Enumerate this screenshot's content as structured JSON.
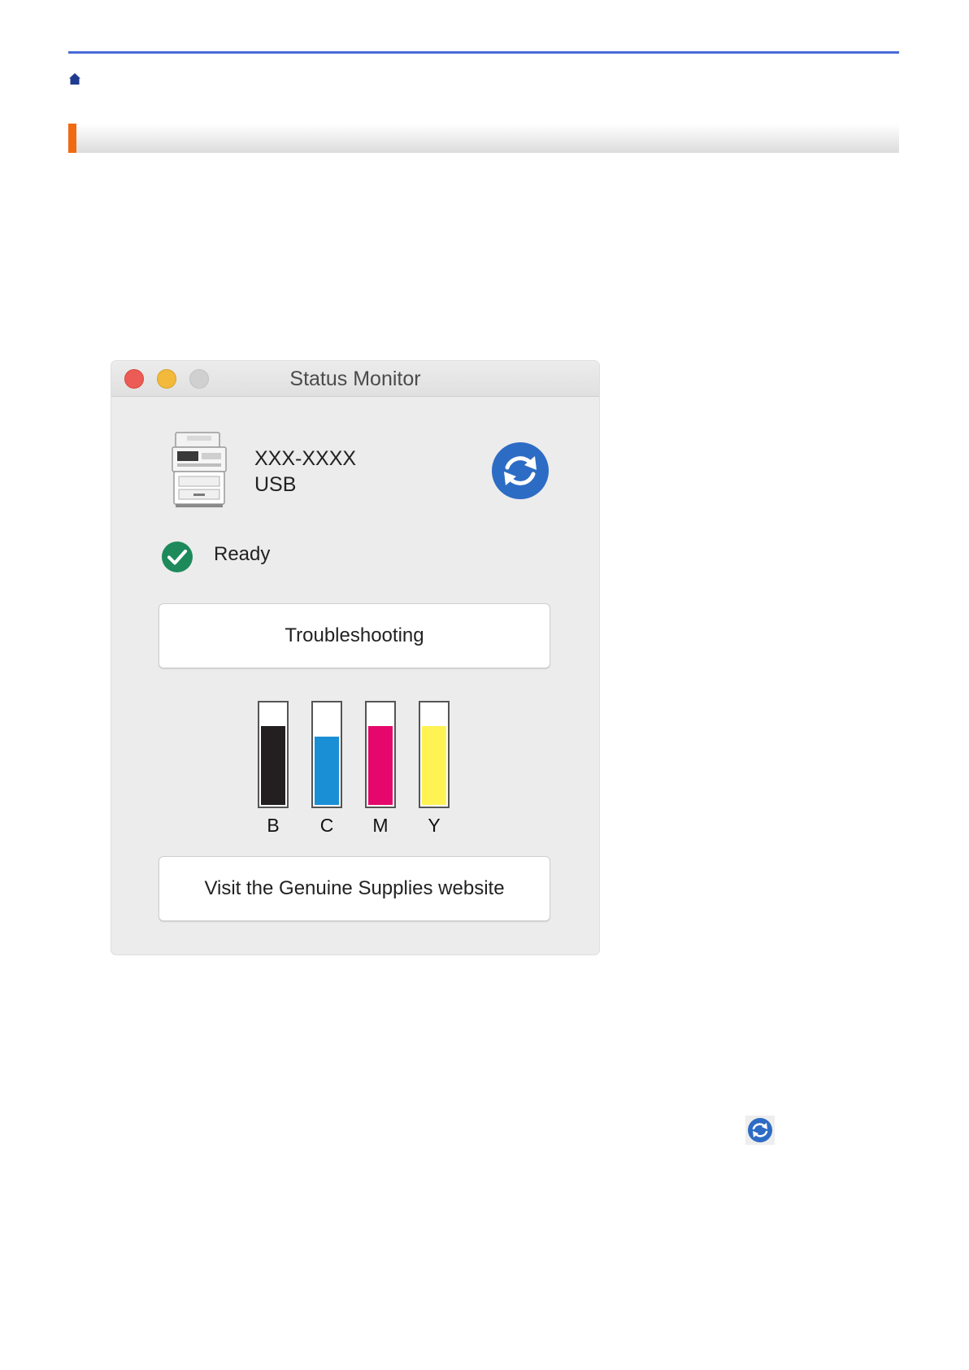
{
  "window": {
    "title": "Status Monitor",
    "device": {
      "model": "XXX-XXXX",
      "connection": "USB"
    },
    "status": {
      "text": "Ready",
      "color": "#1e8a5c"
    },
    "troubleshooting_label": "Troubleshooting",
    "supplies_label": "Visit the Genuine Supplies website",
    "inks": [
      {
        "label": "B",
        "color": "#231f20",
        "level": 0.78
      },
      {
        "label": "C",
        "color": "#1b8fd6",
        "level": 0.68
      },
      {
        "label": "M",
        "color": "#e5076c",
        "level": 0.78
      },
      {
        "label": "Y",
        "color": "#fff353",
        "level": 0.78
      }
    ]
  },
  "colors": {
    "top_rule": "#4a6ad8",
    "section_accent": "#f06a12",
    "refresh_blue": "#2d6cc4"
  },
  "icons": [
    "home-icon",
    "refresh-icon",
    "check-icon",
    "printer-icon"
  ]
}
